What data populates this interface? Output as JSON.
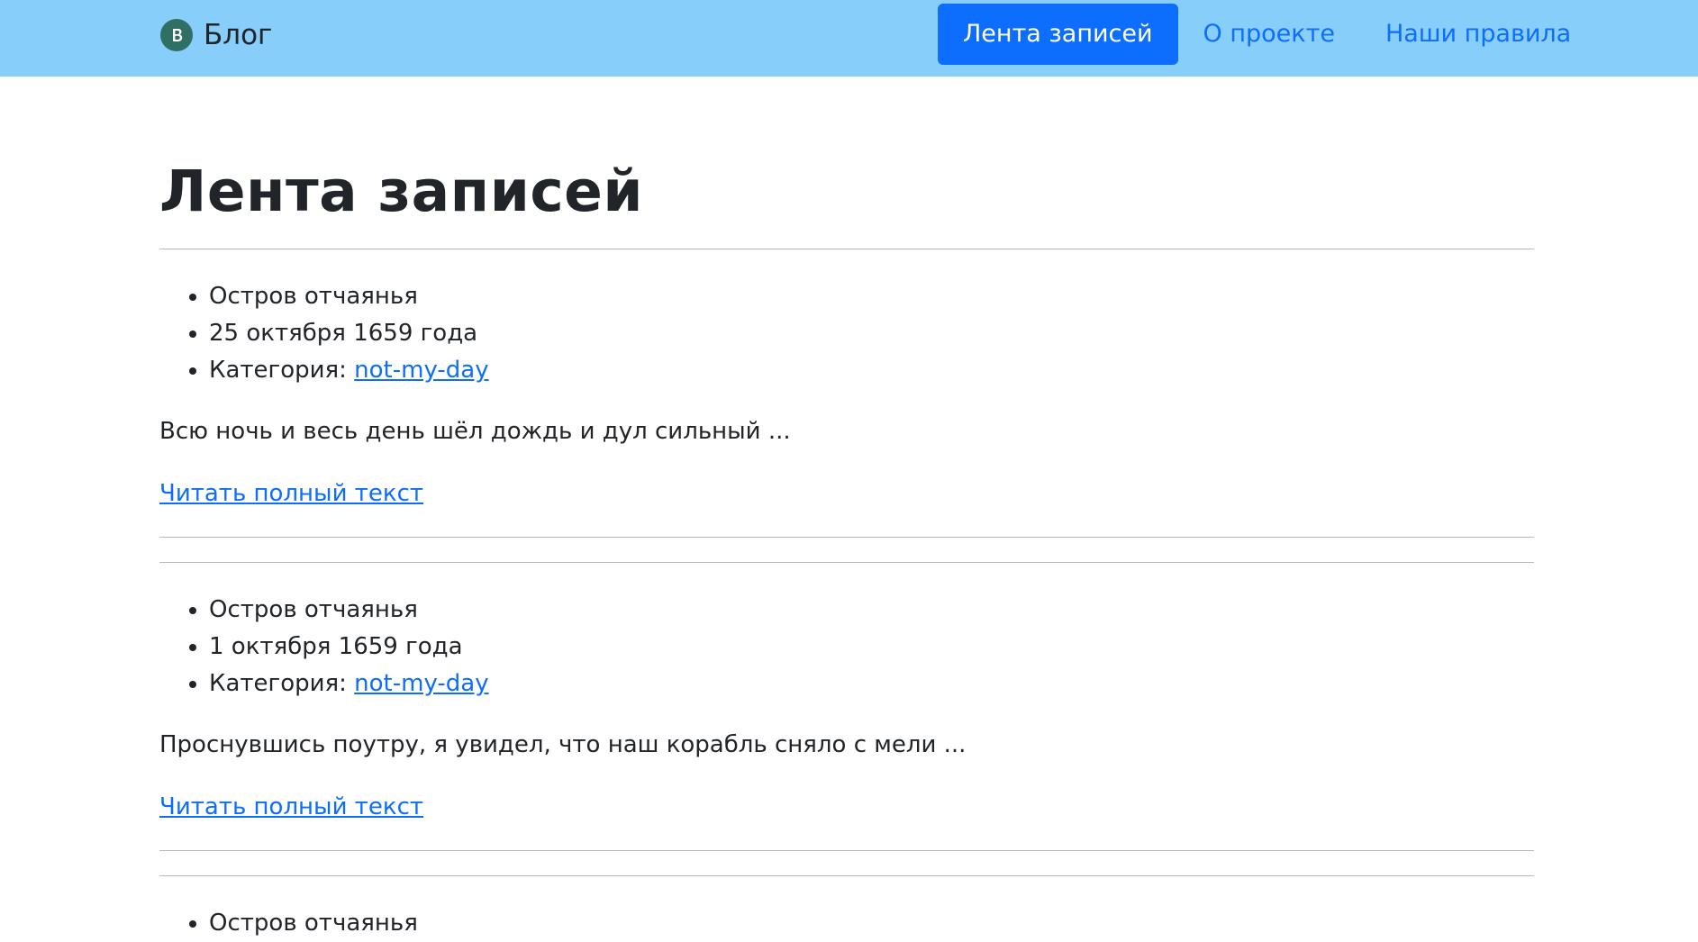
{
  "navbar": {
    "brand": {
      "logo_letter": "B",
      "name": "Блог"
    },
    "links": [
      {
        "label": "Лента записей",
        "active": true
      },
      {
        "label": "О проекте",
        "active": false
      },
      {
        "label": "Наши правила",
        "active": false
      }
    ],
    "colors": {
      "background": "#87cefa",
      "accent": "#0d6efd"
    }
  },
  "page": {
    "title": "Лента записей",
    "category_prefix": "Категория:",
    "read_more_label": "Читать полный текст"
  },
  "posts": [
    {
      "location": "Остров отчаянья",
      "date": "25 октября 1659 года",
      "category": "not-my-day",
      "excerpt": "Всю ночь и весь день шёл дождь и дул сильный ..."
    },
    {
      "location": "Остров отчаянья",
      "date": "1 октября 1659 года",
      "category": "not-my-day",
      "excerpt": "Проснувшись поутру, я увидел, что наш корабль сняло с мели ..."
    },
    {
      "location": "Остров отчаянья"
    }
  ]
}
